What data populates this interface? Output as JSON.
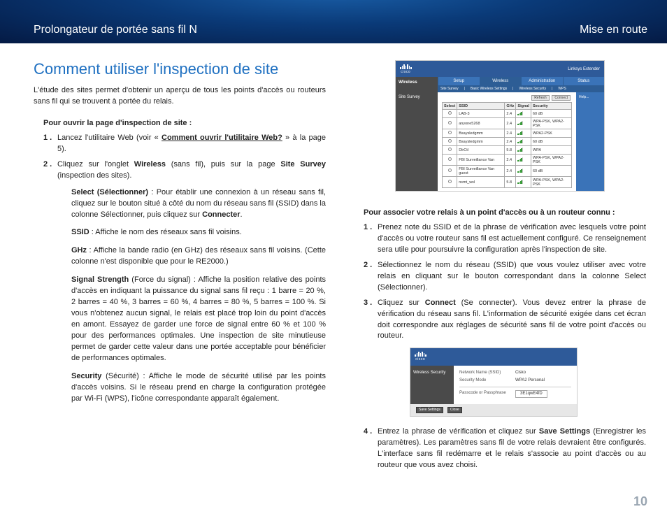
{
  "banner": {
    "left": "Prolongateur de portée sans fil N",
    "right": "Mise en route"
  },
  "section_title": "Comment utiliser l'inspection de site",
  "intro": "L'étude des sites permet d'obtenir un aperçu de tous les points d'accès ou routeurs sans fil qui se trouvent à portée du relais.",
  "left": {
    "subhead": "Pour ouvrir la page d'inspection de site :",
    "steps": {
      "s1": {
        "num": "1 .",
        "a": "Lancez l'utilitaire Web (voir « ",
        "link": "Comment ouvrir l'utilitaire Web?",
        "b": " » à la page 5)."
      },
      "s2": {
        "num": "2 .",
        "a": "Cliquez sur l'onglet ",
        "wireless": "Wireless",
        "b": " (sans fil), puis sur la page ",
        "sitesurvey": "Site Survey",
        "c": " (inspection des sites)."
      }
    },
    "defs": {
      "select": {
        "label": "Select (Sélectionner)",
        "text": " : Pour établir une connexion à un réseau sans fil, cliquez sur le bouton situé à côté du nom du réseau sans fil (SSID) dans la colonne Sélectionner, puis cliquez sur ",
        "connecter": "Connecter",
        "dot": "."
      },
      "ssid": {
        "label": "SSID",
        "text": " : Affiche le nom des réseaux sans fil voisins."
      },
      "ghz": {
        "label": "GHz",
        "text": " : Affiche la bande radio (en GHz) des réseaux sans fil voisins. (Cette colonne n'est disponible que pour le RE2000.)"
      },
      "signal": {
        "label": "Signal Strength",
        "text": " (Force du signal) : Affiche la position relative des points d'accès en indiquant la puissance du signal sans fil reçu : 1 barre = 20 %, 2 barres = 40 %, 3 barres = 60 %, 4 barres = 80 %, 5 barres = 100 %. Si vous n'obtenez aucun signal, le relais est placé trop loin du point d'accès en amont. Essayez de garder une force de signal entre 60 % et 100 % pour des performances optimales. Une inspection de site minutieuse permet de garder cette valeur dans une portée acceptable pour bénéficier de performances optimales."
      },
      "security": {
        "label": "Security",
        "text": " (Sécurité) : Affiche le mode de sécurité utilisé par les points d'accès voisins. Si le réseau prend en charge la configuration protégée par Wi-Fi (WPS), l'icône correspondante apparaît également."
      }
    }
  },
  "right": {
    "subhead": "Pour associer votre relais à un point d'accès ou à un routeur connu :",
    "steps": {
      "s1": {
        "num": "1 .",
        "text": "Prenez note du SSID et de la phrase de vérification avec lesquels votre point d'accès ou votre routeur sans fil est actuellement configuré. Ce renseignement sera utile pour poursuivre la configuration après l'inspection de site."
      },
      "s2": {
        "num": "2 .",
        "text": "Sélectionnez le nom du réseau (SSID) que vous voulez utiliser avec votre relais en cliquant sur le bouton correspondant dans la colonne Select (Sélectionner)."
      },
      "s3": {
        "num": "3 .",
        "a": "Cliquez sur ",
        "connect": "Connect",
        "b": " (Se connecter). Vous devez entrer la phrase de vérification du réseau sans fil. L'information de sécurité exigée dans cet écran doit correspondre aux réglages de sécurité sans fil de votre point d'accès ou routeur."
      },
      "s4": {
        "num": "4 .",
        "a": "Entrez la phrase de vérification et cliquez sur ",
        "save": "Save Settings",
        "b": " (Enregistrer les paramètres). Les paramètres sans fil de votre relais devraient être configurés. L'interface sans fil redémarre et le relais s'associe au point d'accès ou au routeur que vous avez choisi."
      }
    }
  },
  "fig1": {
    "cisco": "cisco",
    "product": "Linksys Extender",
    "side_wireless": "Wireless",
    "tabs": {
      "setup": "Setup",
      "wireless": "Wireless",
      "admin": "Administration",
      "status": "Status"
    },
    "subtabs": {
      "a": "Site Survey",
      "b": "Basic Wireless Settings",
      "c": "Wireless Security",
      "d": "WPS"
    },
    "side_site": "Site Survey",
    "help": "Help...",
    "th": {
      "select": "Select",
      "ssid": "SSID",
      "ghz": "GHz",
      "signal": "Signal",
      "security": "Security"
    },
    "rows": [
      {
        "ssid": "LAB-3",
        "ghz": "2.4",
        "sig": 4,
        "sec": "60 dB"
      },
      {
        "ssid": "anyone5268",
        "ghz": "2.4",
        "sig": 4,
        "sec": "WPA-PSK, WPA2-PSK"
      },
      {
        "ssid": "Bsaysledgmm",
        "ghz": "2.4",
        "sig": 4,
        "sec": "WPA2-PSK"
      },
      {
        "ssid": "Bsaysledgmm",
        "ghz": "2.4",
        "sig": 4,
        "sec": "60 dB"
      },
      {
        "ssid": "DlrCtl",
        "ghz": "5.8",
        "sig": 4,
        "sec": "WPA"
      },
      {
        "ssid": "FBI Surveillance Van",
        "ghz": "2.4",
        "sig": 4,
        "sec": "WPA-PSK, WPA2-PSK"
      },
      {
        "ssid": "FBI Surveillance Van guest",
        "ghz": "2.4",
        "sig": 4,
        "sec": "60 dB"
      },
      {
        "ssid": "nsmt_wsl",
        "ghz": "5.8",
        "sig": 4,
        "sec": "WPA-PSK, WPA2-PSK"
      }
    ],
    "btn_refresh": "Refresh",
    "btn_connect": "Connect"
  },
  "fig2": {
    "cisco": "cisco",
    "left_label": "Wireless Security",
    "rows": {
      "r1": {
        "k": "Network Name (SSID)",
        "v": "Cisko"
      },
      "r2": {
        "k": "Security Mode",
        "v": "WPA2 Personal"
      },
      "r3": {
        "k": "Passcode or Passphrase",
        "v": "3E1qwE4fD"
      }
    },
    "btn_save": "Save Settings",
    "btn_close": "Close"
  },
  "page_number": "10"
}
